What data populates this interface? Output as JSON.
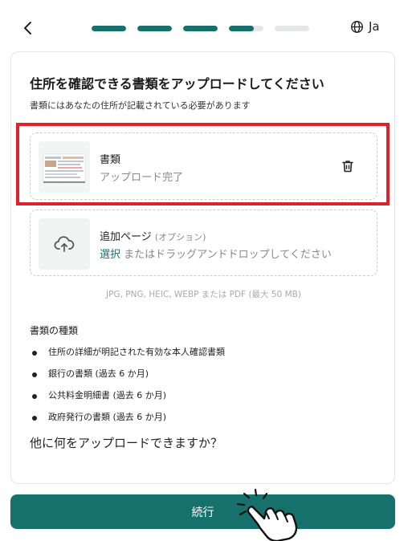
{
  "header": {
    "back_icon": "chevron-left-icon",
    "progress": [
      1,
      1,
      1,
      0.72,
      0
    ],
    "language_icon": "globe-icon",
    "language_label": "Ja"
  },
  "main": {
    "title": "住所を確認できる書類をアップロードしてください",
    "subtitle": "書類にはあなたの住所が記載されている必要があります",
    "uploaded_file": {
      "name": "書類",
      "status": "アップロード完了",
      "delete_icon": "trash-icon"
    },
    "additional_page": {
      "title": "追加ページ",
      "optional": "(オプション)",
      "select_link": "選択",
      "drag_text": " またはドラッグアンドドロップしてください",
      "icon": "cloud-upload-icon"
    },
    "formats": "JPG, PNG, HEIC, WEBP または PDF (最大 50 MB)",
    "document_types_title": "書類の種類",
    "document_types": [
      "住所の詳細が明記された有効な本人確認書類",
      "銀行の書類 (過去 6 か月)",
      "公共料金明細書 (過去 6 か月)",
      "政府発行の書類 (過去 6 か月)"
    ],
    "question": "他に何をアップロードできますか？"
  },
  "footer": {
    "continue_label": "続行",
    "pointer_icon": "hand-pointer-icon"
  },
  "colors": {
    "accent": "#16706b",
    "highlight": "#e0202b"
  }
}
